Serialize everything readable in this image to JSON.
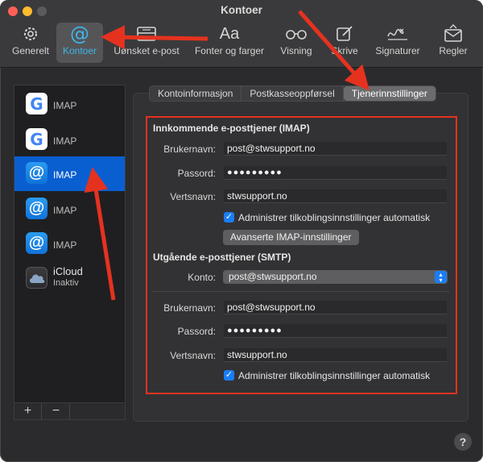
{
  "window": {
    "title": "Kontoer"
  },
  "toolbar": [
    {
      "id": "general",
      "label": "Generelt",
      "icon": "gear-icon"
    },
    {
      "id": "accounts",
      "label": "Kontoer",
      "icon": "at-sign-icon",
      "active": true
    },
    {
      "id": "junk",
      "label": "Uønsket e-post",
      "icon": "junk-tray-icon"
    },
    {
      "id": "fonts",
      "label": "Fonter og farger",
      "icon": "font-aa-icon",
      "glyph": "Aa"
    },
    {
      "id": "viewing",
      "label": "Visning",
      "icon": "glasses-icon"
    },
    {
      "id": "composing",
      "label": "Skrive",
      "icon": "compose-icon"
    },
    {
      "id": "signatures",
      "label": "Signaturer",
      "icon": "signature-icon"
    },
    {
      "id": "rules",
      "label": "Regler",
      "icon": "rules-envelope-icon"
    }
  ],
  "accounts": [
    {
      "type": "google",
      "label": "IMAP",
      "glyph": "G"
    },
    {
      "type": "google",
      "label": "IMAP",
      "glyph": "G"
    },
    {
      "type": "at",
      "label": "IMAP",
      "glyph": "@",
      "selected": true
    },
    {
      "type": "at",
      "label": "IMAP",
      "glyph": "@"
    },
    {
      "type": "at",
      "label": "IMAP",
      "glyph": "@"
    },
    {
      "type": "icloud",
      "label": "iCloud",
      "sublabel": "Inaktiv"
    }
  ],
  "sidebar_buttons": {
    "add": "+",
    "remove": "−"
  },
  "tabs": [
    {
      "label": "Kontoinformasjon"
    },
    {
      "label": "Postkasseoppførsel"
    },
    {
      "label": "Tjenerinnstillinger",
      "active": true
    }
  ],
  "incoming": {
    "title": "Innkommende e-posttjener (IMAP)",
    "username_label": "Brukernavn:",
    "username": "post@stwsupport.no",
    "password_label": "Passord:",
    "password": "●●●●●●●●●",
    "host_label": "Vertsnavn:",
    "host": "stwsupport.no",
    "auto_manage_label": "Administrer tilkoblingsinnstillinger automatisk",
    "auto_manage_checked": true,
    "advanced_button": "Avanserte IMAP-innstillinger"
  },
  "outgoing": {
    "title": "Utgående e-posttjener (SMTP)",
    "account_label": "Konto:",
    "account_value": "post@stwsupport.no",
    "username_label": "Brukernavn:",
    "username": "post@stwsupport.no",
    "password_label": "Passord:",
    "password": "●●●●●●●●●",
    "host_label": "Vertsnavn:",
    "host": "stwsupport.no",
    "auto_manage_label": "Administrer tilkoblingsinnstillinger automatisk",
    "auto_manage_checked": true
  },
  "help": {
    "glyph": "?"
  },
  "colors": {
    "accent": "#1a7df5",
    "annotation": "#e5321f",
    "active_label": "#3fb5e8"
  }
}
